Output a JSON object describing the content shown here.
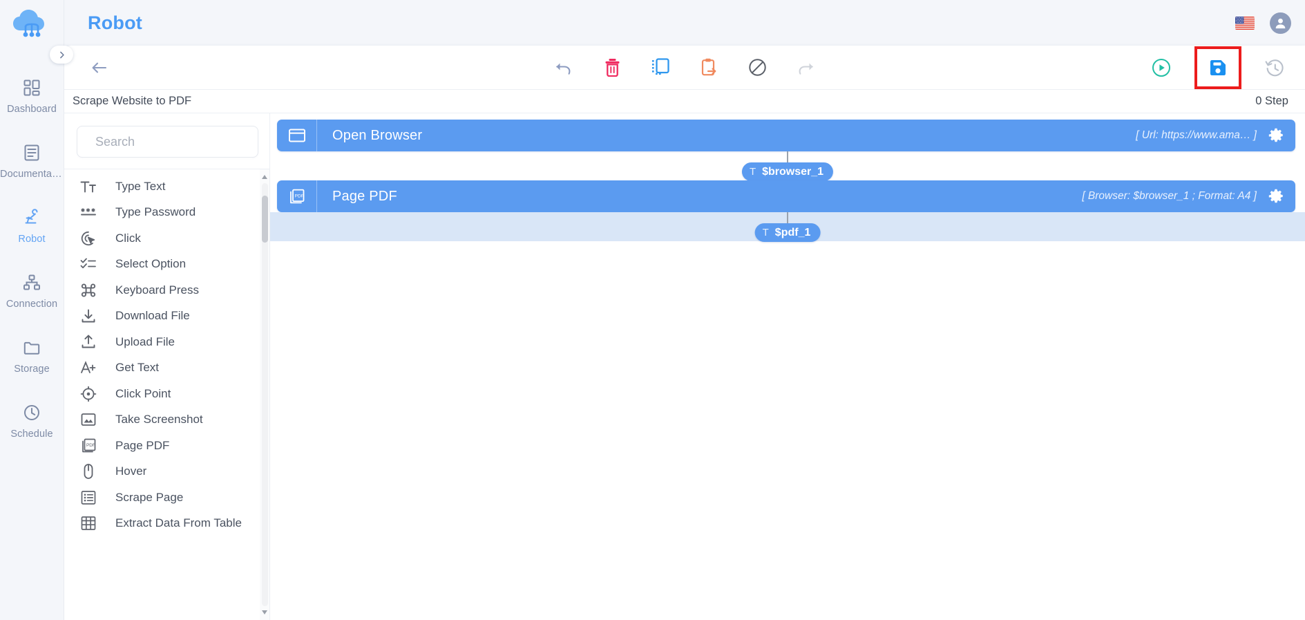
{
  "app": {
    "title": "Robot",
    "logo_icon": "cloud-network-logo",
    "language_flag": "us-flag-icon",
    "avatar_icon": "user-avatar-icon"
  },
  "sidebar": {
    "expand_icon": "chevron-right-icon",
    "items": [
      {
        "label": "Dashboard",
        "icon": "dashboard-grid-icon",
        "active": false
      },
      {
        "label": "Documentati...",
        "icon": "document-lines-icon",
        "active": false
      },
      {
        "label": "Robot",
        "icon": "robot-arm-icon",
        "active": true
      },
      {
        "label": "Connection",
        "icon": "sitemap-icon",
        "active": false
      },
      {
        "label": "Storage",
        "icon": "folder-icon",
        "active": false
      },
      {
        "label": "Schedule",
        "icon": "clock-icon",
        "active": false
      }
    ]
  },
  "toolbar": {
    "back_icon": "arrow-left-icon",
    "center_buttons": [
      {
        "name": "undo-button",
        "icon": "undo-arrow-icon",
        "color": "#8c9bc0"
      },
      {
        "name": "delete-button",
        "icon": "trash-icon",
        "color": "#ef2a5f"
      },
      {
        "name": "copy-button",
        "icon": "copy-dashed-icon",
        "color": "#2f97ee"
      },
      {
        "name": "paste-button",
        "icon": "clipboard-arrow-icon",
        "color": "#f08a5f"
      },
      {
        "name": "disable-button",
        "icon": "block-circle-icon",
        "color": "#5a5f68"
      },
      {
        "name": "redo-button",
        "icon": "redo-arrow-icon",
        "color": "#cfd3da"
      }
    ],
    "right_buttons": [
      {
        "name": "run-button",
        "icon": "play-circle-icon",
        "color": "#22bfa4"
      },
      {
        "name": "save-button",
        "icon": "save-floppy-icon",
        "color": "#1a90f0",
        "highlighted": true,
        "highlight_color": "#ec1c1c"
      },
      {
        "name": "history-button",
        "icon": "history-clock-icon",
        "color": "#b9c0cb"
      }
    ]
  },
  "flow": {
    "name": "Scrape Website to PDF",
    "step_count": "0 Step"
  },
  "search": {
    "placeholder": "Search",
    "value": "",
    "icon": "search-icon"
  },
  "actions": [
    {
      "label": "Type Text",
      "icon": "type-text-icon"
    },
    {
      "label": "Type Password",
      "icon": "password-asterisks-icon"
    },
    {
      "label": "Click",
      "icon": "click-cursor-icon"
    },
    {
      "label": "Select Option",
      "icon": "checklist-icon"
    },
    {
      "label": "Keyboard Press",
      "icon": "command-key-icon"
    },
    {
      "label": "Download File",
      "icon": "download-arrow-icon"
    },
    {
      "label": "Upload File",
      "icon": "upload-arrow-icon"
    },
    {
      "label": "Get Text",
      "icon": "a-plus-icon"
    },
    {
      "label": "Click Point",
      "icon": "crosshair-target-icon"
    },
    {
      "label": "Take Screenshot",
      "icon": "image-mountain-icon"
    },
    {
      "label": "Page PDF",
      "icon": "pdf-pages-icon"
    },
    {
      "label": "Hover",
      "icon": "mouse-icon"
    },
    {
      "label": "Scrape Page",
      "icon": "list-bullets-icon"
    },
    {
      "label": "Extract Data From Table",
      "icon": "table-grid-icon"
    }
  ],
  "canvas": {
    "nodes": [
      {
        "title": "Open Browser",
        "icon": "browser-window-icon",
        "params": "[ Url: https://www.ama… ]",
        "param_key": "Url:",
        "param_value": "https://www.ama…",
        "gear_icon": "gear-icon",
        "output_variable": "$browser_1",
        "variable_type_icon": "T"
      },
      {
        "title": "Page PDF",
        "icon": "pdf-pages-icon",
        "params": "[ Browser: $browser_1 ; Format: A4 ]",
        "param_key": "Browser:",
        "param_value": "$browser_1",
        "param_key2": "Format:",
        "param_value2": "A4",
        "gear_icon": "gear-icon",
        "output_variable": "$pdf_1",
        "variable_type_icon": "T"
      }
    ]
  },
  "colors": {
    "accent": "#4a9bf5",
    "node": "#5b9bf0",
    "highlight": "#ec1c1c",
    "band": "#d9e6f7",
    "page_bg": "#f4f6fa"
  }
}
